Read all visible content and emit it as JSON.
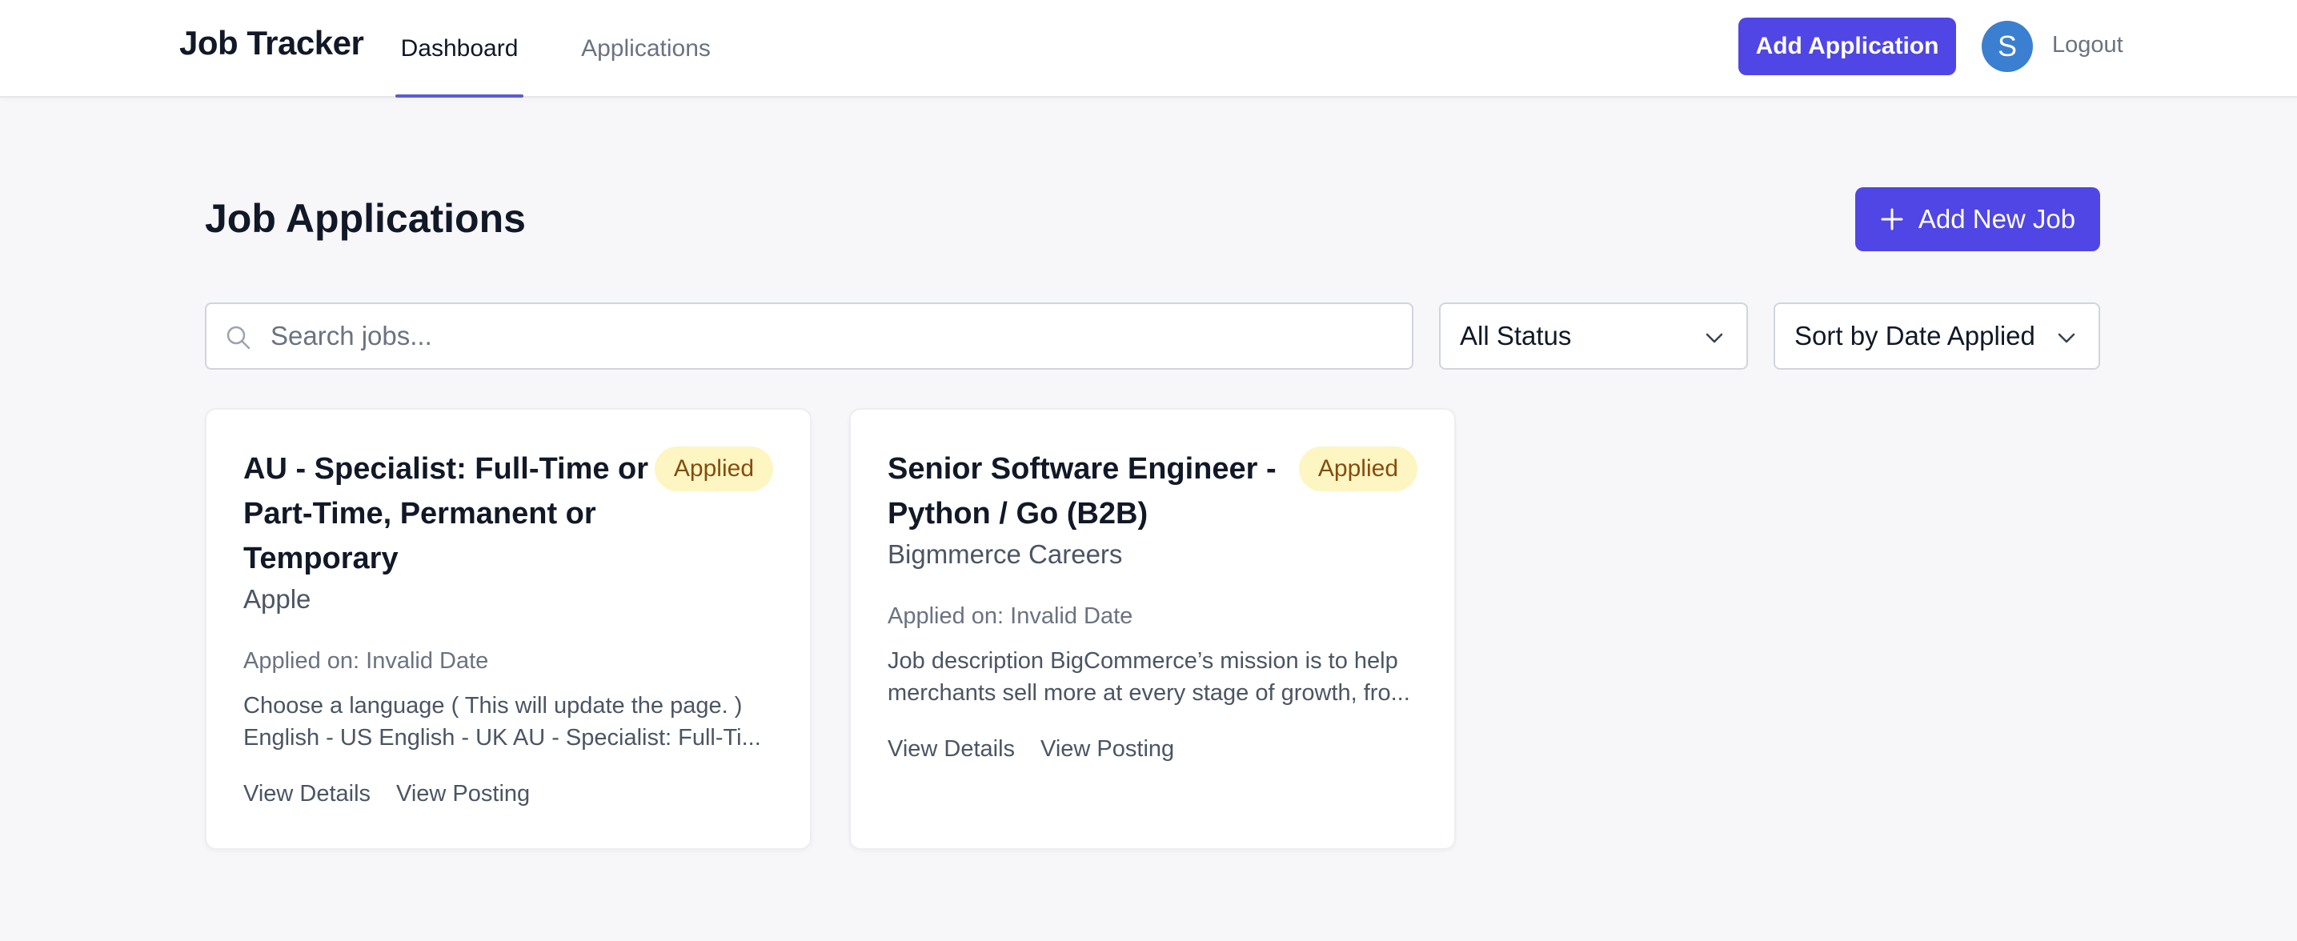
{
  "nav": {
    "brand": "Job Tracker",
    "tabs": [
      {
        "label": "Dashboard",
        "active": true
      },
      {
        "label": "Applications",
        "active": false
      }
    ],
    "add_application_label": "Add Application",
    "avatar_initial": "S",
    "logout_label": "Logout"
  },
  "header": {
    "title": "Job Applications",
    "add_new_job_label": "Add New Job",
    "add_icon": "plus-icon"
  },
  "filters": {
    "search_placeholder": "Search jobs...",
    "search_value": "",
    "search_icon": "search-icon",
    "status_selected": "All Status",
    "sort_selected": "Sort by Date Applied"
  },
  "jobs": [
    {
      "title": "AU - Specialist: Full-Time or Part-Time, Permanent or Temporary",
      "status": "Applied",
      "company": "Apple",
      "applied_on": "Applied on: Invalid Date",
      "description_line1": "Choose a language ( This will update the page. )",
      "description_line2": "English - US English - UK AU - Specialist: Full-Ti...",
      "view_details_label": "View Details",
      "view_posting_label": "View Posting"
    },
    {
      "title": "Senior Software Engineer - Python / Go (B2B)",
      "status": "Applied",
      "company": "Bigmmerce Careers",
      "applied_on": "Applied on: Invalid Date",
      "description_line1": "Job description BigCommerce’s mission is to help",
      "description_line2": "merchants sell more at every stage of growth, fro...",
      "view_details_label": "View Details",
      "view_posting_label": "View Posting"
    }
  ],
  "colors": {
    "accent": "#4f46e5",
    "avatar": "#3b7fd0",
    "badge_bg": "#fdf6c3",
    "badge_text": "#854d0e",
    "background": "#f7f7f9"
  }
}
